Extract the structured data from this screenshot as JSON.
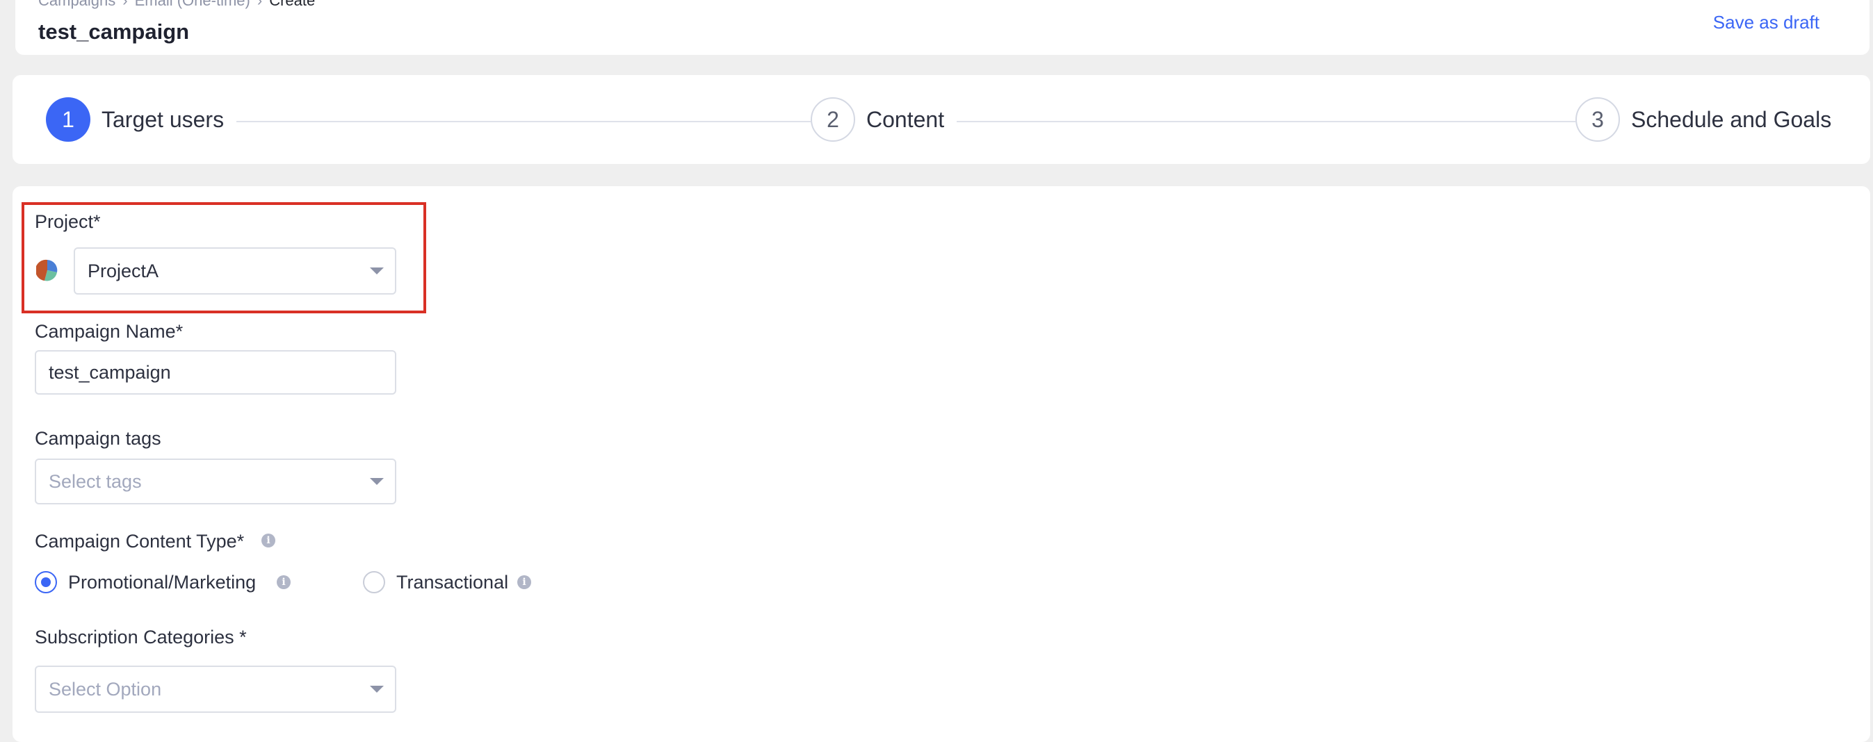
{
  "header": {
    "breadcrumb": [
      "Campaigns",
      "Email (One-time)",
      "Create"
    ],
    "breadcrumb_sep": "›",
    "title": "test_campaign",
    "save_draft": "Save as draft"
  },
  "steps": [
    {
      "number": "1",
      "label": "Target users",
      "state": "active"
    },
    {
      "number": "2",
      "label": "Content",
      "state": "pending"
    },
    {
      "number": "3",
      "label": "Schedule and Goals",
      "state": "pending"
    }
  ],
  "form": {
    "project": {
      "label": "Project*",
      "value": "ProjectA",
      "icon": "project-pie-icon"
    },
    "campaign_name": {
      "label": "Campaign Name*",
      "value": "test_campaign"
    },
    "campaign_tags": {
      "label": "Campaign tags",
      "placeholder": "Select tags"
    },
    "content_type": {
      "label": "Campaign Content Type*",
      "options": [
        {
          "label": "Promotional/Marketing",
          "selected": true
        },
        {
          "label": "Transactional",
          "selected": false
        }
      ]
    },
    "subscription": {
      "label": "Subscription Categories *",
      "placeholder": "Select Option"
    }
  },
  "colors": {
    "accent": "#3b66f5",
    "highlight": "#d93025",
    "background": "#efefef"
  },
  "info_glyph": "i"
}
